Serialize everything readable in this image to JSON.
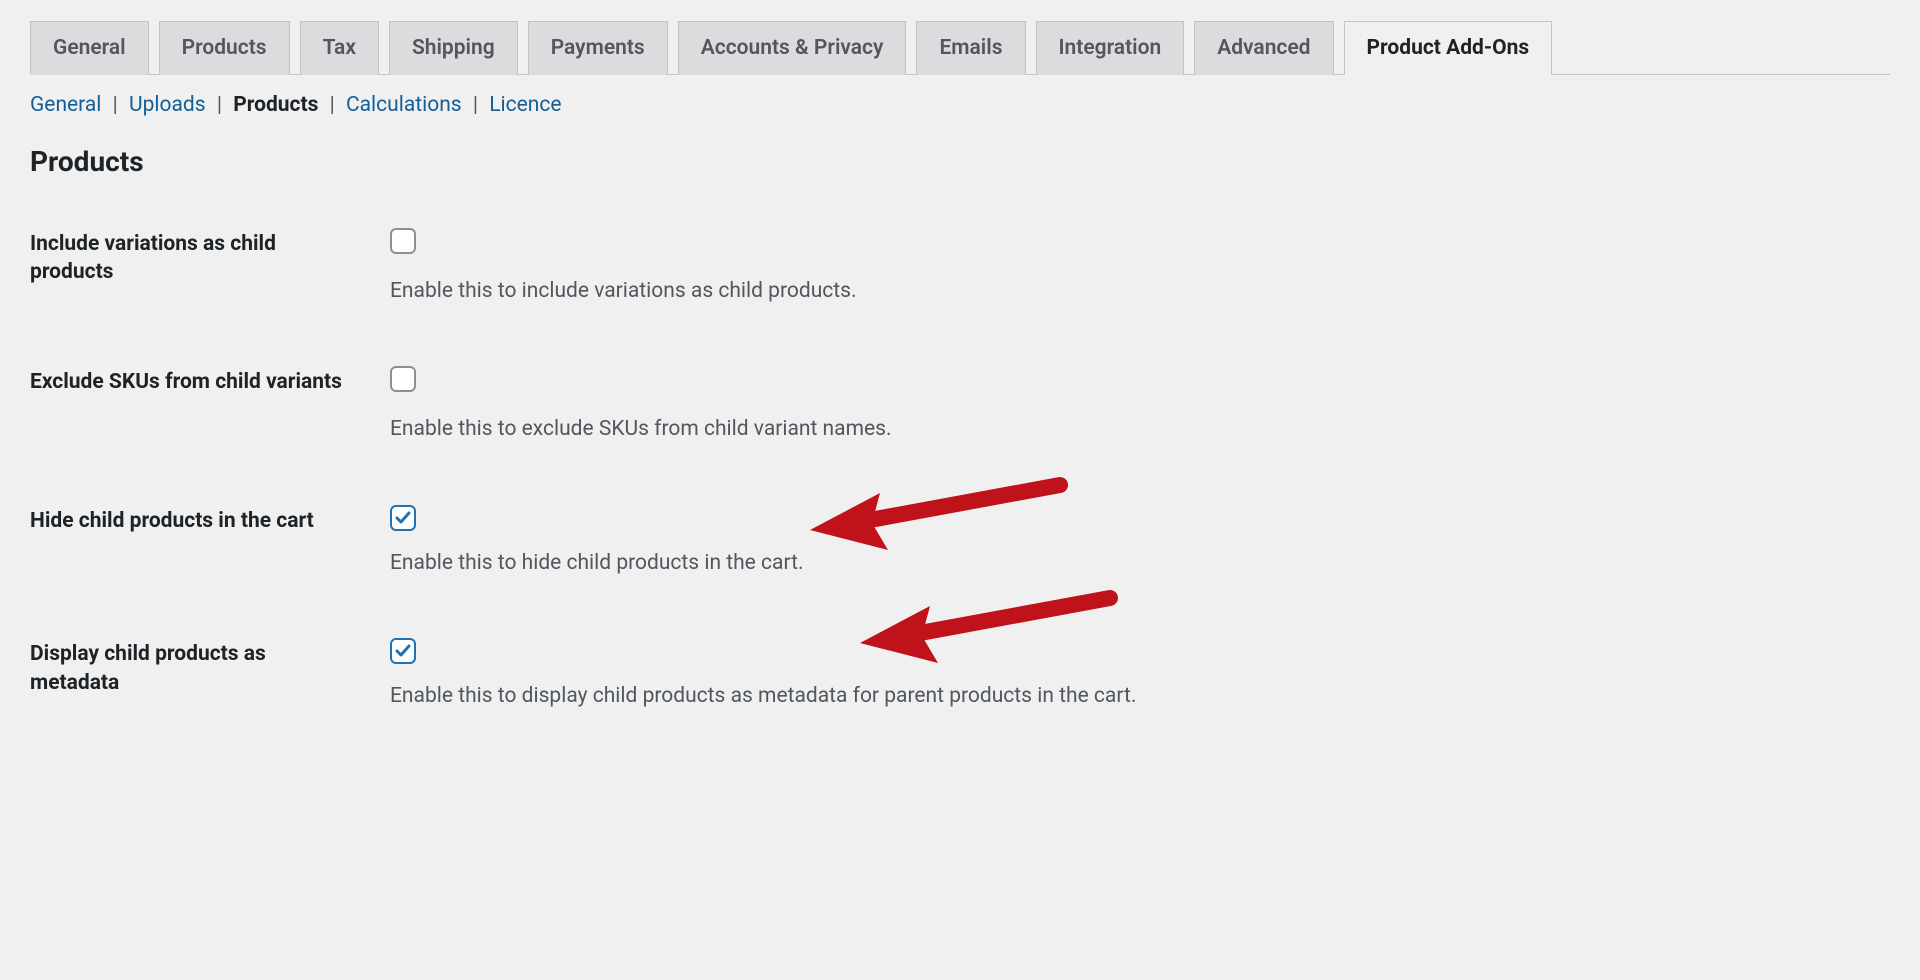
{
  "tabs": {
    "items": [
      {
        "label": "General",
        "active": false
      },
      {
        "label": "Products",
        "active": false
      },
      {
        "label": "Tax",
        "active": false
      },
      {
        "label": "Shipping",
        "active": false
      },
      {
        "label": "Payments",
        "active": false
      },
      {
        "label": "Accounts & Privacy",
        "active": false
      },
      {
        "label": "Emails",
        "active": false
      },
      {
        "label": "Integration",
        "active": false
      },
      {
        "label": "Advanced",
        "active": false
      },
      {
        "label": "Product Add-Ons",
        "active": true
      }
    ]
  },
  "subnav": {
    "items": [
      {
        "label": "General",
        "active": false
      },
      {
        "label": "Uploads",
        "active": false
      },
      {
        "label": "Products",
        "active": true
      },
      {
        "label": "Calculations",
        "active": false
      },
      {
        "label": "Licence",
        "active": false
      }
    ]
  },
  "section_title": "Products",
  "settings": {
    "include_variations": {
      "label": "Include variations as child products",
      "description": "Enable this to include variations as child products.",
      "checked": false
    },
    "exclude_skus": {
      "label": "Exclude SKUs from child variants",
      "description": "Enable this to exclude SKUs from child variant names.",
      "checked": false
    },
    "hide_child_products": {
      "label": "Hide child products in the cart",
      "description": "Enable this to hide child products in the cart.",
      "checked": true
    },
    "display_child_metadata": {
      "label": "Display child products as metadata",
      "description": "Enable this to display child products as metadata for parent products in the cart.",
      "checked": true
    }
  }
}
